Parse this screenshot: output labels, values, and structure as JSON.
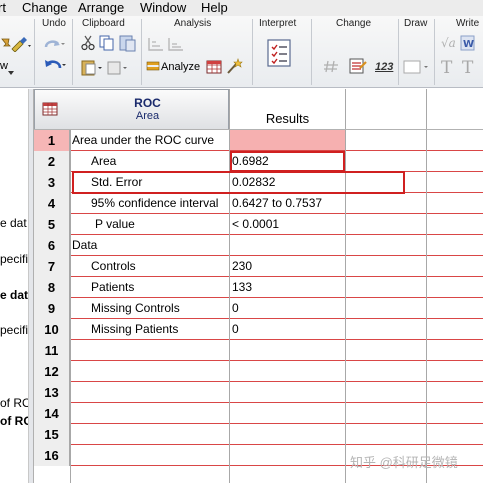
{
  "menubar": {
    "items": [
      "rt",
      "Change",
      "Arrange",
      "Window",
      "Help"
    ]
  },
  "ribbon": {
    "groups": {
      "undo": "Undo",
      "clipboard": "Clipboard",
      "analysis": "Analysis",
      "interpret": "Interpret",
      "change": "Change",
      "draw": "Draw",
      "write": "Write"
    },
    "analyze_label": "Analyze",
    "number_format_label": "123"
  },
  "navigator": {
    "left_label": "w",
    "items": [
      "e dat",
      "pecifi",
      "e dat",
      "pecifi",
      "of RO",
      "of RO"
    ]
  },
  "table": {
    "type_title": "ROC",
    "type_subtitle": "Area",
    "column_header": "Results",
    "rows": [
      {
        "num": "1",
        "title": "Area under the ROC curve",
        "value": ""
      },
      {
        "num": "2",
        "title": "Area",
        "value": "0.6982"
      },
      {
        "num": "3",
        "title": "Std. Error",
        "value": "0.02832"
      },
      {
        "num": "4",
        "title": "95% confidence interval",
        "value": "0.6427 to 0.7537"
      },
      {
        "num": "5",
        "title": "P value",
        "value": "< 0.0001"
      },
      {
        "num": "6",
        "title": "Data",
        "value": ""
      },
      {
        "num": "7",
        "title": "Controls",
        "value": "230"
      },
      {
        "num": "8",
        "title": "Patients",
        "value": "133"
      },
      {
        "num": "9",
        "title": "Missing Controls",
        "value": "0"
      },
      {
        "num": "10",
        "title": "Missing Patients",
        "value": "0"
      },
      {
        "num": "11",
        "title": "",
        "value": ""
      },
      {
        "num": "12",
        "title": "",
        "value": ""
      },
      {
        "num": "13",
        "title": "",
        "value": ""
      },
      {
        "num": "14",
        "title": "",
        "value": ""
      },
      {
        "num": "15",
        "title": "",
        "value": ""
      },
      {
        "num": "16",
        "title": "",
        "value": ""
      }
    ]
  },
  "watermark": "知乎 @科研足微镜",
  "colors": {
    "selected_row_number": "#f6b6b6",
    "highlight_border": "#d02020",
    "row_line": "#d94646",
    "header_text": "#1a2a6c"
  }
}
